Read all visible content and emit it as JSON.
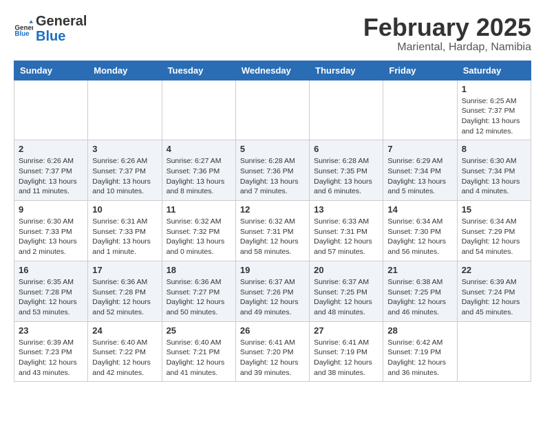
{
  "logo": {
    "text_general": "General",
    "text_blue": "Blue"
  },
  "title": "February 2025",
  "subtitle": "Mariental, Hardap, Namibia",
  "days_of_week": [
    "Sunday",
    "Monday",
    "Tuesday",
    "Wednesday",
    "Thursday",
    "Friday",
    "Saturday"
  ],
  "weeks": [
    [
      {
        "day": "",
        "info": ""
      },
      {
        "day": "",
        "info": ""
      },
      {
        "day": "",
        "info": ""
      },
      {
        "day": "",
        "info": ""
      },
      {
        "day": "",
        "info": ""
      },
      {
        "day": "",
        "info": ""
      },
      {
        "day": "1",
        "info": "Sunrise: 6:25 AM\nSunset: 7:37 PM\nDaylight: 13 hours and 12 minutes."
      }
    ],
    [
      {
        "day": "2",
        "info": "Sunrise: 6:26 AM\nSunset: 7:37 PM\nDaylight: 13 hours and 11 minutes."
      },
      {
        "day": "3",
        "info": "Sunrise: 6:26 AM\nSunset: 7:37 PM\nDaylight: 13 hours and 10 minutes."
      },
      {
        "day": "4",
        "info": "Sunrise: 6:27 AM\nSunset: 7:36 PM\nDaylight: 13 hours and 8 minutes."
      },
      {
        "day": "5",
        "info": "Sunrise: 6:28 AM\nSunset: 7:36 PM\nDaylight: 13 hours and 7 minutes."
      },
      {
        "day": "6",
        "info": "Sunrise: 6:28 AM\nSunset: 7:35 PM\nDaylight: 13 hours and 6 minutes."
      },
      {
        "day": "7",
        "info": "Sunrise: 6:29 AM\nSunset: 7:34 PM\nDaylight: 13 hours and 5 minutes."
      },
      {
        "day": "8",
        "info": "Sunrise: 6:30 AM\nSunset: 7:34 PM\nDaylight: 13 hours and 4 minutes."
      }
    ],
    [
      {
        "day": "9",
        "info": "Sunrise: 6:30 AM\nSunset: 7:33 PM\nDaylight: 13 hours and 2 minutes."
      },
      {
        "day": "10",
        "info": "Sunrise: 6:31 AM\nSunset: 7:33 PM\nDaylight: 13 hours and 1 minute."
      },
      {
        "day": "11",
        "info": "Sunrise: 6:32 AM\nSunset: 7:32 PM\nDaylight: 13 hours and 0 minutes."
      },
      {
        "day": "12",
        "info": "Sunrise: 6:32 AM\nSunset: 7:31 PM\nDaylight: 12 hours and 58 minutes."
      },
      {
        "day": "13",
        "info": "Sunrise: 6:33 AM\nSunset: 7:31 PM\nDaylight: 12 hours and 57 minutes."
      },
      {
        "day": "14",
        "info": "Sunrise: 6:34 AM\nSunset: 7:30 PM\nDaylight: 12 hours and 56 minutes."
      },
      {
        "day": "15",
        "info": "Sunrise: 6:34 AM\nSunset: 7:29 PM\nDaylight: 12 hours and 54 minutes."
      }
    ],
    [
      {
        "day": "16",
        "info": "Sunrise: 6:35 AM\nSunset: 7:28 PM\nDaylight: 12 hours and 53 minutes."
      },
      {
        "day": "17",
        "info": "Sunrise: 6:36 AM\nSunset: 7:28 PM\nDaylight: 12 hours and 52 minutes."
      },
      {
        "day": "18",
        "info": "Sunrise: 6:36 AM\nSunset: 7:27 PM\nDaylight: 12 hours and 50 minutes."
      },
      {
        "day": "19",
        "info": "Sunrise: 6:37 AM\nSunset: 7:26 PM\nDaylight: 12 hours and 49 minutes."
      },
      {
        "day": "20",
        "info": "Sunrise: 6:37 AM\nSunset: 7:25 PM\nDaylight: 12 hours and 48 minutes."
      },
      {
        "day": "21",
        "info": "Sunrise: 6:38 AM\nSunset: 7:25 PM\nDaylight: 12 hours and 46 minutes."
      },
      {
        "day": "22",
        "info": "Sunrise: 6:39 AM\nSunset: 7:24 PM\nDaylight: 12 hours and 45 minutes."
      }
    ],
    [
      {
        "day": "23",
        "info": "Sunrise: 6:39 AM\nSunset: 7:23 PM\nDaylight: 12 hours and 43 minutes."
      },
      {
        "day": "24",
        "info": "Sunrise: 6:40 AM\nSunset: 7:22 PM\nDaylight: 12 hours and 42 minutes."
      },
      {
        "day": "25",
        "info": "Sunrise: 6:40 AM\nSunset: 7:21 PM\nDaylight: 12 hours and 41 minutes."
      },
      {
        "day": "26",
        "info": "Sunrise: 6:41 AM\nSunset: 7:20 PM\nDaylight: 12 hours and 39 minutes."
      },
      {
        "day": "27",
        "info": "Sunrise: 6:41 AM\nSunset: 7:19 PM\nDaylight: 12 hours and 38 minutes."
      },
      {
        "day": "28",
        "info": "Sunrise: 6:42 AM\nSunset: 7:19 PM\nDaylight: 12 hours and 36 minutes."
      },
      {
        "day": "",
        "info": ""
      }
    ]
  ]
}
